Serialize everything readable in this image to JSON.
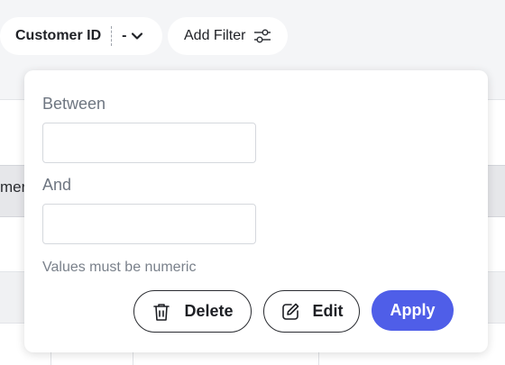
{
  "colors": {
    "accent": "#4f5ee8",
    "background": "#f4f5f7",
    "popover": "#ffffff"
  },
  "filters": {
    "customer_chip_label": "Customer ID",
    "customer_chip_value": "-",
    "add_filter_label": "Add Filter"
  },
  "table": {
    "header_partial_text": "mer"
  },
  "popover": {
    "between_label": "Between",
    "between_value": "",
    "and_label": "And",
    "and_value": "",
    "hint": "Values must be numeric",
    "delete_label": "Delete",
    "edit_label": "Edit",
    "apply_label": "Apply"
  },
  "icons": {
    "chevron": "chevron-down-icon",
    "filter": "sliders-icon",
    "delete": "trash-icon",
    "edit": "pencil-icon"
  }
}
